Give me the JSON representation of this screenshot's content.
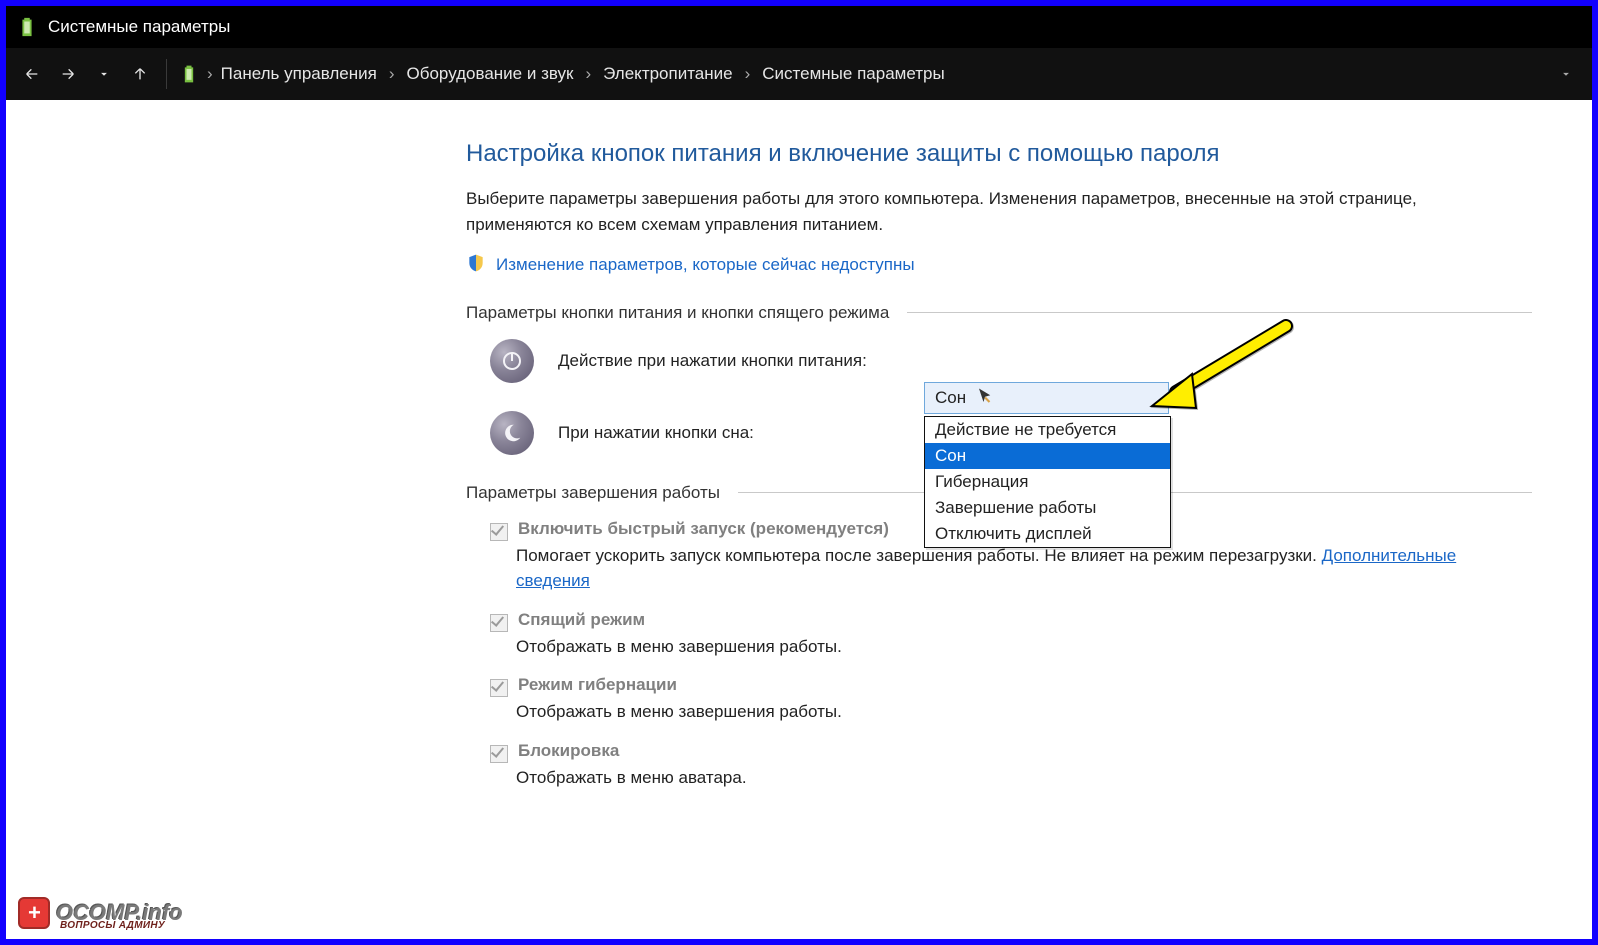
{
  "window": {
    "title": "Системные параметры"
  },
  "breadcrumbs": {
    "items": [
      "Панель управления",
      "Оборудование и звук",
      "Электропитание",
      "Системные параметры"
    ]
  },
  "page": {
    "heading": "Настройка кнопок питания и включение защиты с помощью пароля",
    "description": "Выберите параметры завершения работы для этого компьютера. Изменения параметров, внесенные на этой странице, применяются ко всем схемам управления питанием.",
    "unlock_link": "Изменение параметров, которые сейчас недоступны"
  },
  "sections": {
    "buttons": "Параметры кнопки питания и кнопки спящего режима",
    "shutdown": "Параметры завершения работы"
  },
  "rows": {
    "power": "Действие при нажатии кнопки питания:",
    "sleep": "При нажатии кнопки сна:"
  },
  "dropdown": {
    "selected": "Сон",
    "options": [
      "Действие не требуется",
      "Сон",
      "Гибернация",
      "Завершение работы",
      "Отключить дисплей"
    ],
    "highlight_index": 1
  },
  "checks": {
    "fast": {
      "label": "Включить быстрый запуск (рекомендуется)",
      "desc_a": "Помогает ускорить запуск компьютера после завершения работы. Не влияет на режим перезагрузки. ",
      "link": "Дополнительные сведения"
    },
    "sleep": {
      "label": "Спящий режим",
      "desc": "Отображать в меню завершения работы."
    },
    "hib": {
      "label": "Режим гибернации",
      "desc": "Отображать в меню завершения работы."
    },
    "lock": {
      "label": "Блокировка",
      "desc": "Отображать в меню аватара."
    }
  },
  "watermark": {
    "text": "OCOMP.info",
    "sub": "ВОПРОСЫ АДМИНУ"
  }
}
